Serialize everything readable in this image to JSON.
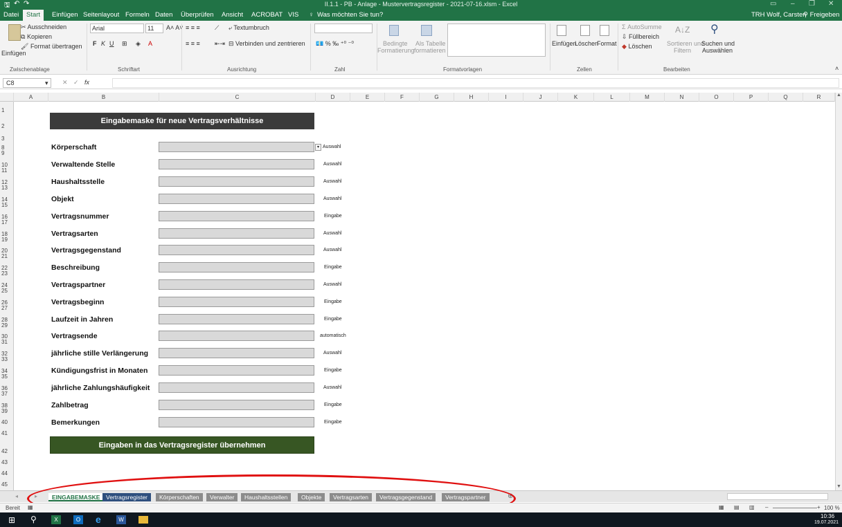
{
  "window": {
    "title": "II.1.1 - PB - Anlage - Mustervertragsregister - 2021-07-16.xlsm - Excel",
    "user": "TRH Wolf, Carsten",
    "share": "Freigeben"
  },
  "menu": {
    "items": [
      "Datei",
      "Start",
      "Einfügen",
      "Seitenlayout",
      "Formeln",
      "Daten",
      "Überprüfen",
      "Ansicht",
      "ACROBAT",
      "VIS"
    ],
    "active": "Start",
    "tell_me": "Was möchten Sie tun?"
  },
  "ribbon": {
    "clipboard": {
      "paste": "Einfügen",
      "cut": "Ausschneiden",
      "copy": "Kopieren",
      "format_painter": "Format übertragen",
      "group": "Zwischenablage"
    },
    "font": {
      "name": "Arial",
      "size": "11",
      "group": "Schriftart"
    },
    "alignment": {
      "wrap": "Textumbruch",
      "merge": "Verbinden und zentrieren",
      "group": "Ausrichtung"
    },
    "number": {
      "group": "Zahl"
    },
    "styles": {
      "conditional": "Bedingte",
      "conditional2": "Formatierung",
      "as_table": "Als Tabelle",
      "as_table2": "formatieren",
      "group": "Formatvorlagen"
    },
    "cells": {
      "insert": "Einfügen",
      "delete": "Löschen",
      "format": "Format",
      "group": "Zellen"
    },
    "editing": {
      "autosum": "AutoSumme",
      "fill": "Füllbereich",
      "clear": "Löschen",
      "sort": "Sortieren und",
      "sort2": "Filtern",
      "find": "Suchen und",
      "find2": "Auswählen",
      "group": "Bearbeiten"
    }
  },
  "formula_bar": {
    "cell_ref": "C8",
    "fx": "fx",
    "value": ""
  },
  "columns": [
    "A",
    "B",
    "C",
    "D",
    "E",
    "F",
    "G",
    "H",
    "I",
    "J",
    "K",
    "L",
    "M",
    "N",
    "O",
    "P",
    "Q",
    "R"
  ],
  "rows": [
    "1",
    "2",
    "3",
    "8",
    "9",
    "10",
    "11",
    "12",
    "13",
    "14",
    "15",
    "16",
    "17",
    "18",
    "19",
    "20",
    "21",
    "22",
    "23",
    "24",
    "25",
    "26",
    "27",
    "28",
    "29",
    "30",
    "31",
    "32",
    "33",
    "34",
    "35",
    "36",
    "37",
    "38",
    "39",
    "40",
    "41",
    "42",
    "43",
    "44",
    "45"
  ],
  "form": {
    "header": "Eingabemaske für neue Vertragsverhältnisse",
    "fields": [
      {
        "label": "Körperschaft",
        "hint": "Auswahl"
      },
      {
        "label": "Verwaltende Stelle",
        "hint": "Auswahl"
      },
      {
        "label": "Haushaltsstelle",
        "hint": "Auswahl"
      },
      {
        "label": "Objekt",
        "hint": "Auswahl"
      },
      {
        "label": "Vertragsnummer",
        "hint": "Eingabe"
      },
      {
        "label": "Vertragsarten",
        "hint": "Auswahl"
      },
      {
        "label": "Vertragsgegenstand",
        "hint": "Auswahl"
      },
      {
        "label": "Beschreibung",
        "hint": "Eingabe"
      },
      {
        "label": "Vertragspartner",
        "hint": "Auswahl"
      },
      {
        "label": "Vertragsbeginn",
        "hint": "Eingabe"
      },
      {
        "label": "Laufzeit in Jahren",
        "hint": "Eingabe"
      },
      {
        "label": "Vertragsende",
        "hint": "automatisch"
      },
      {
        "label": "jährliche stille Verlängerung",
        "hint": "Auswahl"
      },
      {
        "label": "Kündigungsfrist in Monaten",
        "hint": "Eingabe"
      },
      {
        "label": "jährliche Zahlungshäufigkeit",
        "hint": "Auswahl"
      },
      {
        "label": "Zahlbetrag",
        "hint": "Eingabe"
      },
      {
        "label": "Bemerkungen",
        "hint": "Eingabe"
      }
    ],
    "submit": "Eingaben in das Vertragsregister übernehmen"
  },
  "sheets": [
    "EINGABEMASKE",
    "Vertragsregister",
    "Körperschaften",
    "Verwalter",
    "Haushaltsstellen",
    "Objekte",
    "Vertragsarten",
    "Vertragsgegenstand",
    "Vertragspartner"
  ],
  "active_sheet": "EINGABEMASKE",
  "status": {
    "ready": "Bereit",
    "zoom": "100 %"
  },
  "taskbar": {
    "time": "10:36",
    "date": "19.07.2021"
  }
}
